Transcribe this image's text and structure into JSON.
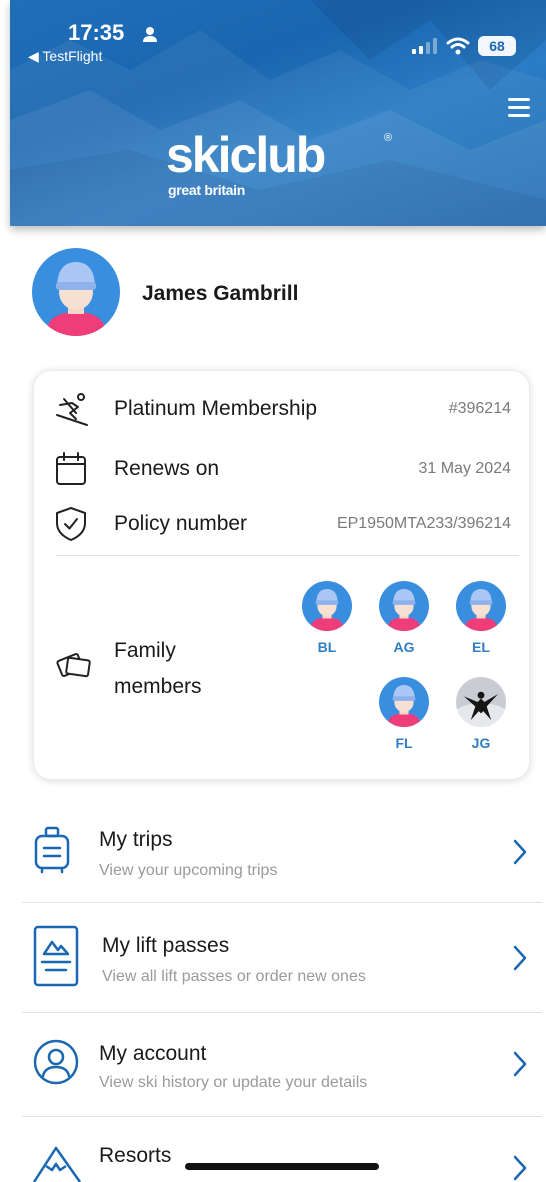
{
  "status_bar": {
    "time": "17:35",
    "back_label": "TestFlight",
    "battery": "68"
  },
  "brand": {
    "logo_word": "skiclub",
    "logo_mark": "®",
    "logo_sub": "great britain",
    "primary_color": "#1b68b2",
    "accent_color": "#2f7fc4"
  },
  "profile": {
    "name": "James Gambrill"
  },
  "membership": {
    "tier_label": "Platinum Membership",
    "tier_number": "#396214",
    "renew_label": "Renews on",
    "renew_date": "31 May 2024",
    "policy_label": "Policy number",
    "policy_value": "EP1950MTA233/396214",
    "family_label": "Family members",
    "family": [
      {
        "initials": "BL"
      },
      {
        "initials": "AG"
      },
      {
        "initials": "EL"
      },
      {
        "initials": "FL"
      },
      {
        "initials": "JG"
      }
    ]
  },
  "menu": [
    {
      "title": "My trips",
      "subtitle": "View your upcoming trips",
      "icon": "suitcase-icon"
    },
    {
      "title": "My lift passes",
      "subtitle": "View all lift passes or order new ones",
      "icon": "lift-pass-icon"
    },
    {
      "title": "My account",
      "subtitle": "View ski history or update your details",
      "icon": "account-icon"
    },
    {
      "title": "Resorts",
      "subtitle": "",
      "icon": "mountain-icon"
    }
  ]
}
